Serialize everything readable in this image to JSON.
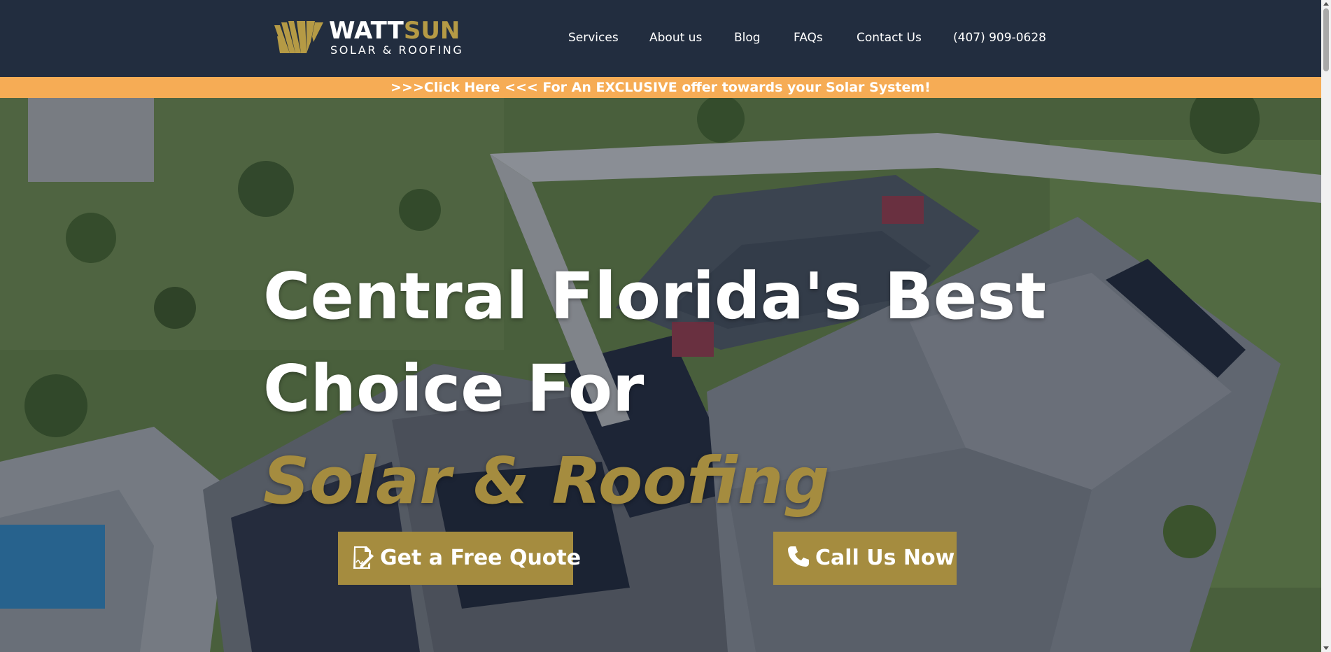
{
  "brand": {
    "name_part1": "WATT",
    "name_part2": "SUN",
    "tagline": "SOLAR & ROOFING",
    "white": "#ffffff",
    "gold": "#b59a45",
    "logo_icon": "sun-rays-icon"
  },
  "nav": {
    "items": [
      {
        "label": "Services"
      },
      {
        "label": "About us"
      },
      {
        "label": "Blog"
      },
      {
        "label": "FAQs"
      },
      {
        "label": "Contact Us"
      },
      {
        "label": "(407) 909-0628"
      }
    ]
  },
  "banner": {
    "text": ">>>Click Here <<< For An EXCLUSIVE offer towards your Solar System!",
    "color": "#f6ac55"
  },
  "hero": {
    "line1": "Central Florida's Best",
    "line2": "Choice For",
    "highlight": "Solar & Roofing",
    "highlight_color": "#a58c3f",
    "background": "aerial-house-roof-solar-panels",
    "buttons": {
      "quote_label": "Get a Free Quote",
      "quote_icon": "document-signature-icon",
      "call_label": "Call Us Now",
      "call_icon": "phone-icon"
    }
  },
  "colors": {
    "header_bg": "#222d3f",
    "button_bg": "#a58c3f"
  }
}
